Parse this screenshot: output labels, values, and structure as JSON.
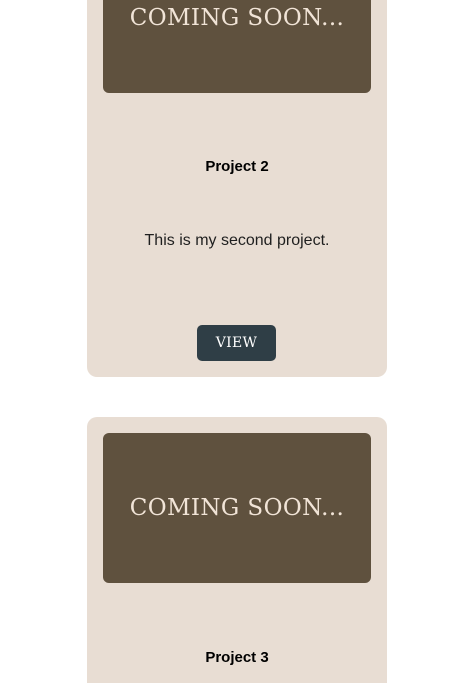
{
  "colors": {
    "card_background": "#e8ddd3",
    "thumbnail_background": "#5f513e",
    "thumbnail_text": "#f1e4d7",
    "button_background": "#2f3e46",
    "button_text": "#ffffff"
  },
  "projects": [
    {
      "thumbnail_text": "COMING SOON...",
      "title": "Project 2",
      "description": "This is my second project.",
      "button_label": "VIEW"
    },
    {
      "thumbnail_text": "COMING SOON...",
      "title": "Project 3"
    }
  ]
}
